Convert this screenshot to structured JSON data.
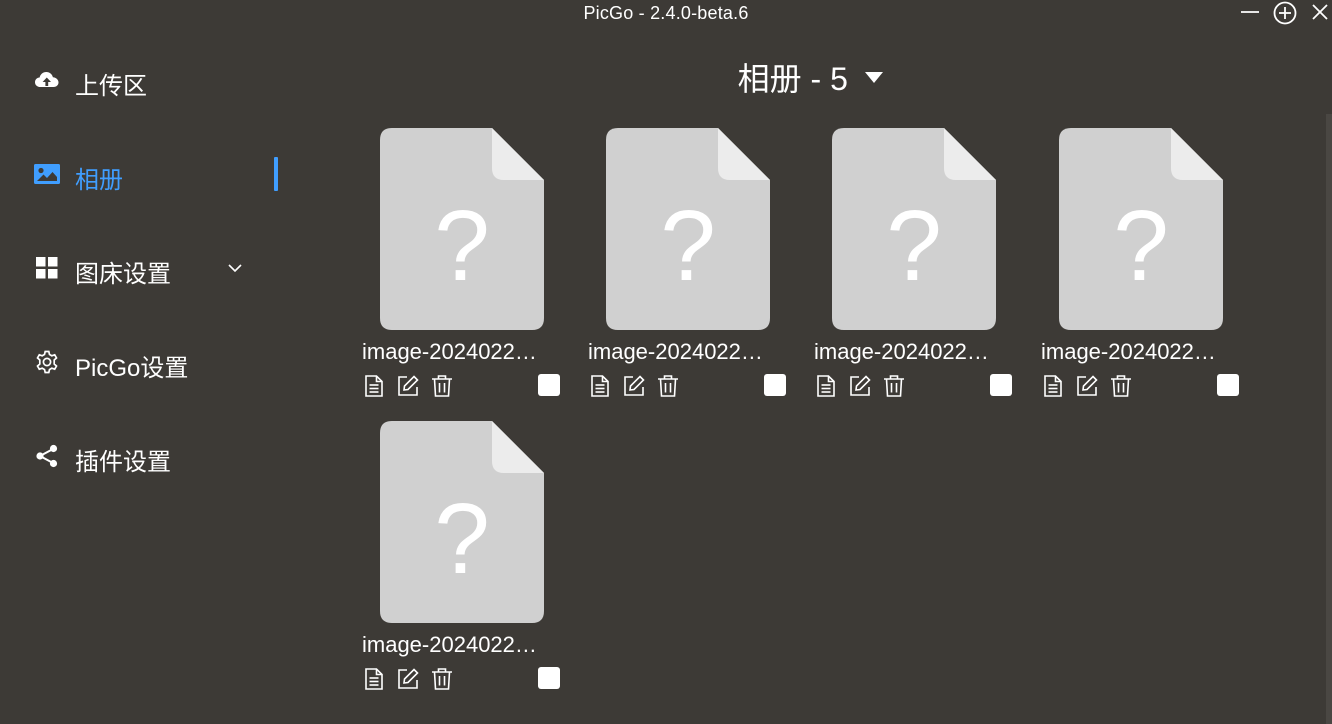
{
  "window": {
    "title": "PicGo - 2.4.0-beta.6"
  },
  "sidebar": {
    "items": [
      {
        "label": "上传区",
        "icon": "cloud-upload-icon",
        "active": false
      },
      {
        "label": "相册",
        "icon": "image-icon",
        "active": true
      },
      {
        "label": "图床设置",
        "icon": "grid-icon",
        "active": false,
        "expandable": true
      },
      {
        "label": "PicGo设置",
        "icon": "gear-icon",
        "active": false
      },
      {
        "label": "插件设置",
        "icon": "share-icon",
        "active": false
      }
    ]
  },
  "gallery": {
    "title": "相册 - 5",
    "images": [
      {
        "name": "image-2024022…"
      },
      {
        "name": "image-2024022…"
      },
      {
        "name": "image-2024022…"
      },
      {
        "name": "image-2024022…"
      },
      {
        "name": "image-2024022…"
      }
    ]
  },
  "colors": {
    "background": "#3d3a36",
    "accent": "#409eff",
    "thumb_fill": "#d0d0d0"
  }
}
